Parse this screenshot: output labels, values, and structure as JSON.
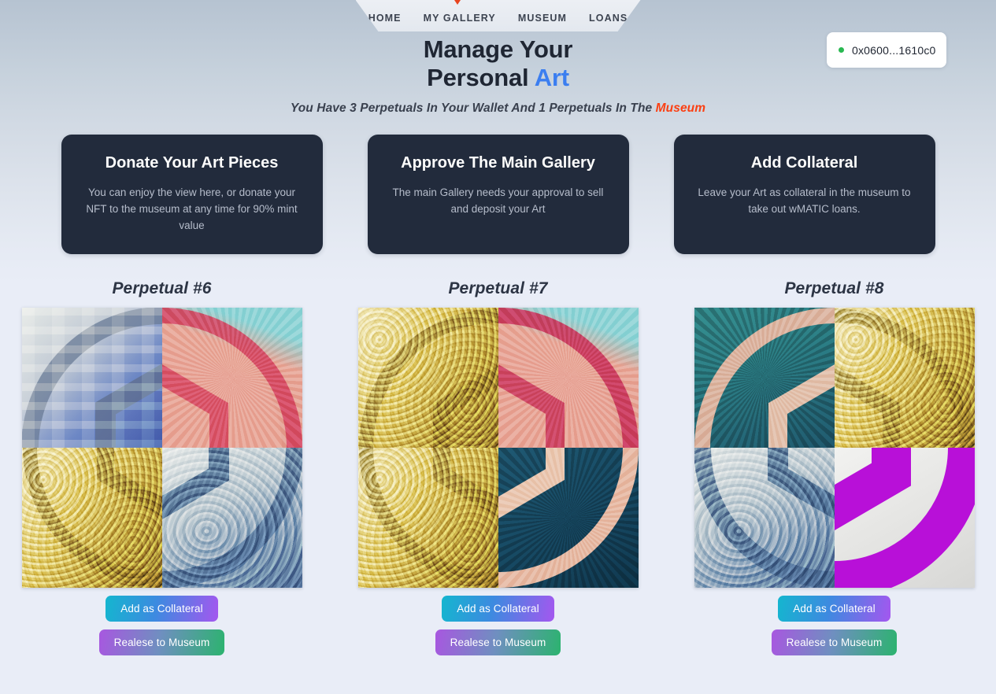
{
  "nav": {
    "items": [
      {
        "label": "HOME"
      },
      {
        "label": "MY GALLERY"
      },
      {
        "label": "MUSEUM"
      },
      {
        "label": "LOANS"
      }
    ],
    "active_index": 1,
    "pointer_color": "#e8441f"
  },
  "wallet": {
    "address": "0x0600...1610c0",
    "status_color": "#29b851"
  },
  "hero": {
    "title_line1": "Manage Your",
    "title_line2_plain": "Personal ",
    "title_line2_accent": "Art",
    "accent_color": "#3b7ef0",
    "subtitle_plain": "You Have 3 Perpetuals In Your Wallet And 1 Perpetuals In The ",
    "subtitle_accent": "Museum",
    "subtitle_accent_color": "#fb3f12",
    "wallet_count": 3,
    "museum_count": 1
  },
  "info_cards": [
    {
      "title": "Donate Your Art Pieces",
      "text": "You can enjoy the view here, or donate your NFT to the museum at any time for 90% mint value"
    },
    {
      "title": "Approve The Main Gallery",
      "text": "The main Gallery needs your approval to sell and deposit your Art"
    },
    {
      "title": "Add Collateral",
      "text": "Leave your Art as collateral in the museum to take out wMATIC loans."
    }
  ],
  "card_style": {
    "background": "#222b3c",
    "title_color": "#fdfdfc",
    "text_color": "#b6bdcb"
  },
  "nfts": [
    {
      "title": "Perpetual #6",
      "id": 6,
      "collateral_label": "Add as Collateral",
      "release_label": "Realese to Museum",
      "quadrants": [
        {
          "position": "top-left",
          "style": "blue-blocks",
          "emblem_color": "#8d9aa6",
          "bg_color": "#e3e7e2"
        },
        {
          "position": "top-right",
          "style": "salmon-teal",
          "emblem_color": "#e0998c",
          "bg_color": "#8fd4d6"
        },
        {
          "position": "bottom-left",
          "style": "gold-swirl",
          "emblem_color": "#b49b4a",
          "bg_color": "#d9c478"
        },
        {
          "position": "bottom-right",
          "style": "wave-blue",
          "emblem_color": "#6f8498",
          "bg_color": "#cfd6d8"
        }
      ]
    },
    {
      "title": "Perpetual #7",
      "id": 7,
      "collateral_label": "Add as Collateral",
      "release_label": "Realese to Museum",
      "quadrants": [
        {
          "position": "top-left",
          "style": "gold-swirl",
          "emblem_color": "#b49b4a",
          "bg_color": "#d9c478"
        },
        {
          "position": "top-right",
          "style": "salmon-teal",
          "emblem_color": "#e0998c",
          "bg_color": "#8fd4d6"
        },
        {
          "position": "bottom-left",
          "style": "gold-swirl",
          "emblem_color": "#b49b4a",
          "bg_color": "#d9c478"
        },
        {
          "position": "bottom-right",
          "style": "navy-teal",
          "emblem_color": "#f2c0a8",
          "bg_color": "#15455c"
        }
      ]
    },
    {
      "title": "Perpetual #8",
      "id": 8,
      "collateral_label": "Add as Collateral",
      "release_label": "Realese to Museum",
      "quadrants": [
        {
          "position": "top-left",
          "style": "teal-facet",
          "emblem_color": "#f0bba4",
          "bg_color": "#2f7f80"
        },
        {
          "position": "top-right",
          "style": "gold-swirl",
          "emblem_color": "#b49b4a",
          "bg_color": "#d9c478"
        },
        {
          "position": "bottom-left",
          "style": "wave-blue",
          "emblem_color": "#6f8498",
          "bg_color": "#cfd6d8"
        },
        {
          "position": "bottom-right",
          "style": "purple-flat",
          "emblem_color": "#b810d8",
          "bg_color": "#efeeec"
        }
      ]
    }
  ],
  "colors": {
    "page_bg_top": "#b6c3d1",
    "page_bg_bottom": "#e9edf7",
    "btn_collateral_from": "#14b6cf",
    "btn_collateral_to": "#a457ef",
    "btn_release_from": "#a857e0",
    "btn_release_to": "#2cb36f"
  }
}
